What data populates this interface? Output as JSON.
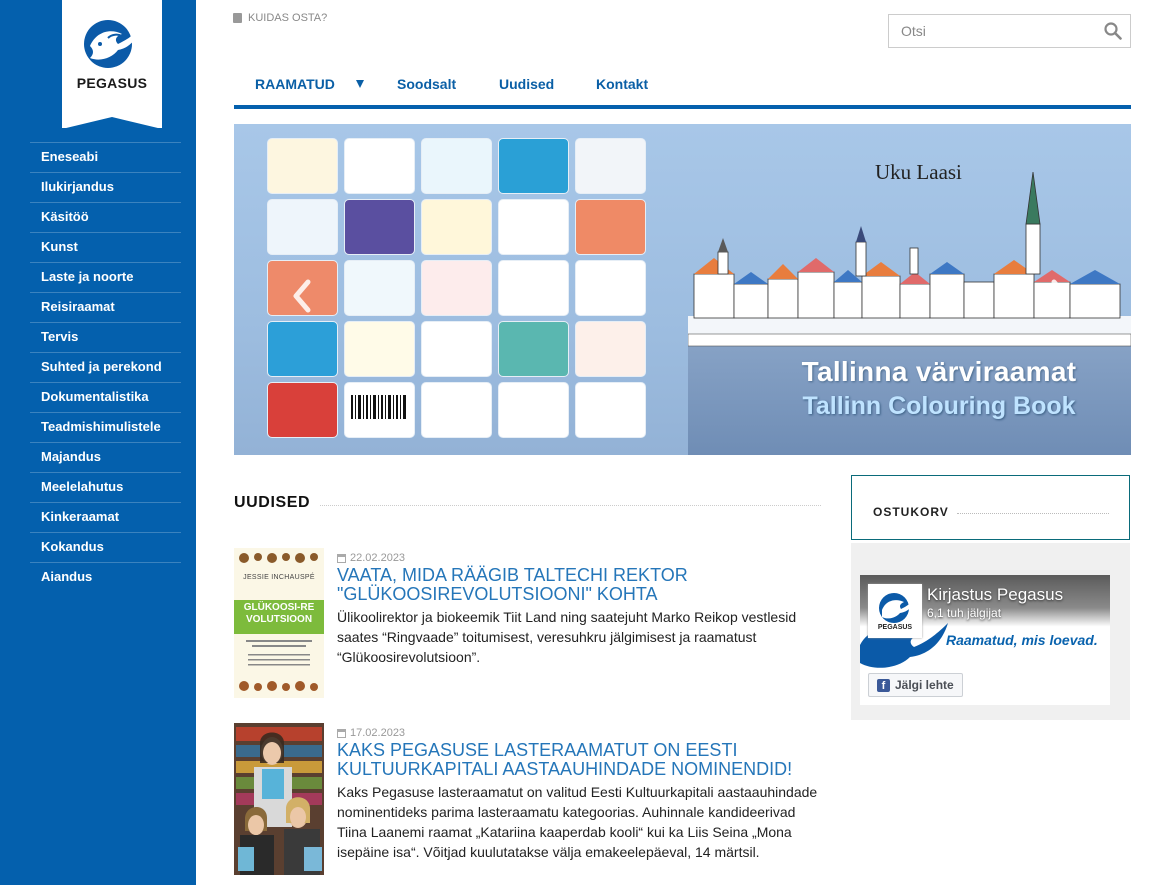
{
  "sidebar": {
    "logo_text": "PEGASUS",
    "items": [
      {
        "label": "Eneseabi"
      },
      {
        "label": "Ilukirjandus"
      },
      {
        "label": "Käsitöö"
      },
      {
        "label": "Kunst"
      },
      {
        "label": "Laste ja noorte"
      },
      {
        "label": "Reisiraamat"
      },
      {
        "label": "Tervis"
      },
      {
        "label": "Suhted ja perekond"
      },
      {
        "label": "Dokumentalistika"
      },
      {
        "label": "Teadmishimulistele"
      },
      {
        "label": "Majandus"
      },
      {
        "label": "Meelelahutus"
      },
      {
        "label": "Kinkeraamat"
      },
      {
        "label": "Kokandus"
      },
      {
        "label": "Aiandus"
      }
    ]
  },
  "topbar": {
    "howto_label": "KUIDAS OSTA?",
    "search_placeholder": "Otsi"
  },
  "mainnav": {
    "books": "RAAMATUD",
    "sale": "Soodsalt",
    "news": "Uudised",
    "contact": "Kontakt"
  },
  "banner": {
    "author": "Uku Laasi",
    "title": "Tallinna värviraamat",
    "subtitle": "Tallinn Colouring Book"
  },
  "news": {
    "section_title": "UUDISED",
    "items": [
      {
        "date": "22.02.2023",
        "title": "VAATA, MIDA RÄÄGIB TALTECHI REKTOR \"GLÜKOOSIREVOLUTSIOONI\" KOHTA",
        "text": "Ülikoolirektor ja biokeemik Tiit Land ning saatejuht Marko Reikop vestlesid saates “Ringvaade” toitumisest, veresuhkru jälgimisest ja raamatust “Glükoosirevolutsioon”.",
        "thumb_author": "JESSIE INCHAUSPÉ",
        "thumb_title": "GLÜKOOSI-REVOLUTSIOON"
      },
      {
        "date": "17.02.2023",
        "title": "KAKS PEGASUSE LASTERAAMATUT ON EESTI KULTUURKAPITALI AASTAAUHINDADE NOMINENDID!",
        "text": "Kaks Pegasuse lasteraamatut on valitud Eesti Kultuurkapitali aastaauhindade nominentideks parima lasteraamatu kategoorias. Auhinnale kandideerivad Tiina Laanemi raamat „Katariina kaaperdab kooli“ kui ka Liis Seina „Mona isepäine isa“. Võitjad kuulutatakse välja emakeelepäeval, 14 märtsil."
      }
    ]
  },
  "cart": {
    "title": "OSTUKORV"
  },
  "facebook": {
    "page_name": "Kirjastus Pegasus",
    "followers": "6,1 tuh jälgijat",
    "slogan": "Raamatud, mis loevad.",
    "follow_label": "Jälgi lehte",
    "avatar_text": "PEGASUS"
  },
  "colors": {
    "brand_blue": "#0460ad",
    "link_blue": "#2576b9"
  }
}
